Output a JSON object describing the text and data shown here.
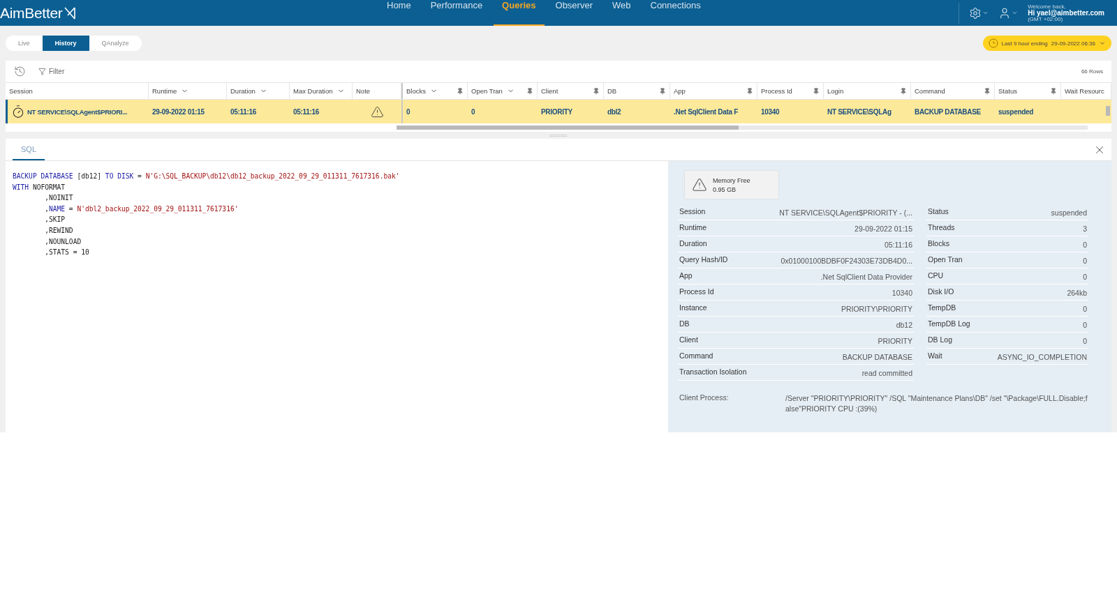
{
  "header": {
    "logo": "AimBetter",
    "nav": [
      {
        "label": "Home",
        "selected": false
      },
      {
        "label": "Performance",
        "selected": false
      },
      {
        "label": "Queries",
        "selected": true
      },
      {
        "label": "Observer",
        "selected": false
      },
      {
        "label": "Web",
        "selected": false
      },
      {
        "label": "Connections",
        "selected": false
      }
    ],
    "user": {
      "greeting": "Welcome back,",
      "name": "Hi yael@aimbetter.com",
      "timezone": "(GMT +02:00)"
    }
  },
  "modes": [
    {
      "label": "Live",
      "selected": false
    },
    {
      "label": "History",
      "selected": true
    },
    {
      "label": "QAnalyze",
      "selected": false
    }
  ],
  "time_range": {
    "label": "Last 9 hour ending",
    "value": "29-09-2022 06:36"
  },
  "toolbar": {
    "filter": "Filter",
    "row_count": "66 Rows"
  },
  "table": {
    "columns": [
      {
        "label": "Session",
        "sortable": false,
        "pinnable": false
      },
      {
        "label": "Runtime",
        "sortable": true,
        "pinnable": false
      },
      {
        "label": "Duration",
        "sortable": true,
        "pinnable": false
      },
      {
        "label": "Max Duration",
        "sortable": true,
        "pinnable": false
      },
      {
        "label": "Note",
        "sortable": false,
        "pinnable": false
      },
      {
        "label": "Blocks",
        "sortable": true,
        "pinnable": true
      },
      {
        "label": "Open Tran",
        "sortable": true,
        "pinnable": true
      },
      {
        "label": "Client",
        "sortable": false,
        "pinnable": true
      },
      {
        "label": "DB",
        "sortable": false,
        "pinnable": true
      },
      {
        "label": "App",
        "sortable": false,
        "pinnable": true
      },
      {
        "label": "Process Id",
        "sortable": false,
        "pinnable": true
      },
      {
        "label": "Login",
        "sortable": false,
        "pinnable": true
      },
      {
        "label": "Command",
        "sortable": false,
        "pinnable": true
      },
      {
        "label": "Status",
        "sortable": false,
        "pinnable": true
      },
      {
        "label": "Wait Resourc",
        "sortable": false,
        "pinnable": false
      }
    ],
    "rows": [
      {
        "selected": true,
        "cells": [
          {
            "kind": "session",
            "text": "NT SERVICE\\SQLAgent$PRIORI..."
          },
          {
            "kind": "text",
            "text": "29-09-2022 01:15"
          },
          {
            "kind": "text",
            "text": "05:11:16"
          },
          {
            "kind": "text",
            "text": "05:11:16"
          },
          {
            "kind": "warning"
          },
          {
            "kind": "text",
            "text": "0"
          },
          {
            "kind": "text",
            "text": "0"
          },
          {
            "kind": "text",
            "text": "PRIORITY"
          },
          {
            "kind": "text",
            "text": "dbl2"
          },
          {
            "kind": "text",
            "text": ".Net SqlClient Data F"
          },
          {
            "kind": "text",
            "text": "10340"
          },
          {
            "kind": "text",
            "text": "NT SERVICE\\SQLAg"
          },
          {
            "kind": "text",
            "text": "BACKUP DATABASE"
          },
          {
            "kind": "text",
            "text": "suspended"
          }
        ]
      }
    ]
  },
  "detail": {
    "tab": {
      "label": "SQL",
      "selected": true
    },
    "sql": [
      [
        {
          "kind": "keyword",
          "text": "BACKUP DATABASE"
        },
        {
          "kind": "plain",
          "text": " [db12] "
        },
        {
          "kind": "keyword",
          "text": "TO DISK"
        },
        {
          "kind": "plain",
          "text": " = "
        },
        {
          "kind": "string",
          "text": "N'G:\\SQL_BACKUP\\db12\\db12_backup_2022_09_29_011311_7617316.bak'"
        }
      ],
      [
        {
          "kind": "keyword",
          "text": "WITH"
        },
        {
          "kind": "plain",
          "text": " NOFORMAT"
        }
      ],
      [
        {
          "kind": "plain",
          "text": "        ,NOINIT"
        }
      ],
      [
        {
          "kind": "plain",
          "text": "        ,"
        },
        {
          "kind": "keyword",
          "text": "NAME"
        },
        {
          "kind": "plain",
          "text": " = "
        },
        {
          "kind": "string",
          "text": "N'dbl2_backup_2022_09_29_011311_7617316'"
        }
      ],
      [
        {
          "kind": "plain",
          "text": "        ,SKIP"
        }
      ],
      [
        {
          "kind": "plain",
          "text": "        ,REWIND"
        }
      ],
      [
        {
          "kind": "plain",
          "text": "        ,NOUNLOAD"
        }
      ],
      [
        {
          "kind": "plain",
          "text": "        ,STATS = 10"
        }
      ]
    ],
    "alert": {
      "label": "Memory Free",
      "value": "0.95 GB"
    },
    "left": [
      {
        "label": "Session",
        "value": "NT SERVICE\\SQLAgent$PRIORITY - (..."
      },
      {
        "label": "Runtime",
        "value": "29-09-2022 01:15"
      },
      {
        "label": "Duration",
        "value": "05:11:16"
      },
      {
        "label": "Query Hash/ID",
        "value": "0x01000100BDBF0F24303E73DB4D0..."
      },
      {
        "label": "App",
        "value": ".Net SqlClient Data Provider"
      },
      {
        "label": "Process Id",
        "value": "10340"
      },
      {
        "label": "Instance",
        "value": "PRIORITY\\PRIORITY"
      },
      {
        "label": "DB",
        "value": "db12"
      },
      {
        "label": "Client",
        "value": "PRIORITY"
      },
      {
        "label": "Command",
        "value": "BACKUP DATABASE"
      },
      {
        "label": "Transaction Isolation",
        "value": "read committed"
      }
    ],
    "right": [
      {
        "label": "Status",
        "value": "suspended"
      },
      {
        "label": "Threads",
        "value": "3"
      },
      {
        "label": "Blocks",
        "value": "0"
      },
      {
        "label": "Open Tran",
        "value": "0"
      },
      {
        "label": "CPU",
        "value": "0"
      },
      {
        "label": "Disk I/O",
        "value": "264kb"
      },
      {
        "label": "TempDB",
        "value": "0"
      },
      {
        "label": "TempDB Log",
        "value": "0"
      },
      {
        "label": "DB Log",
        "value": "0"
      },
      {
        "label": "Wait",
        "value": "ASYNC_IO_COMPLETION"
      }
    ],
    "client_process": {
      "label": "Client Process:",
      "value": "/Server \"PRIORITY\\PRIORITY\" /SQL \"Maintenance Plans\\DB\" /set \"\\Package\\FULL.Disable;false\"PRIORITY CPU :(39%)"
    }
  }
}
